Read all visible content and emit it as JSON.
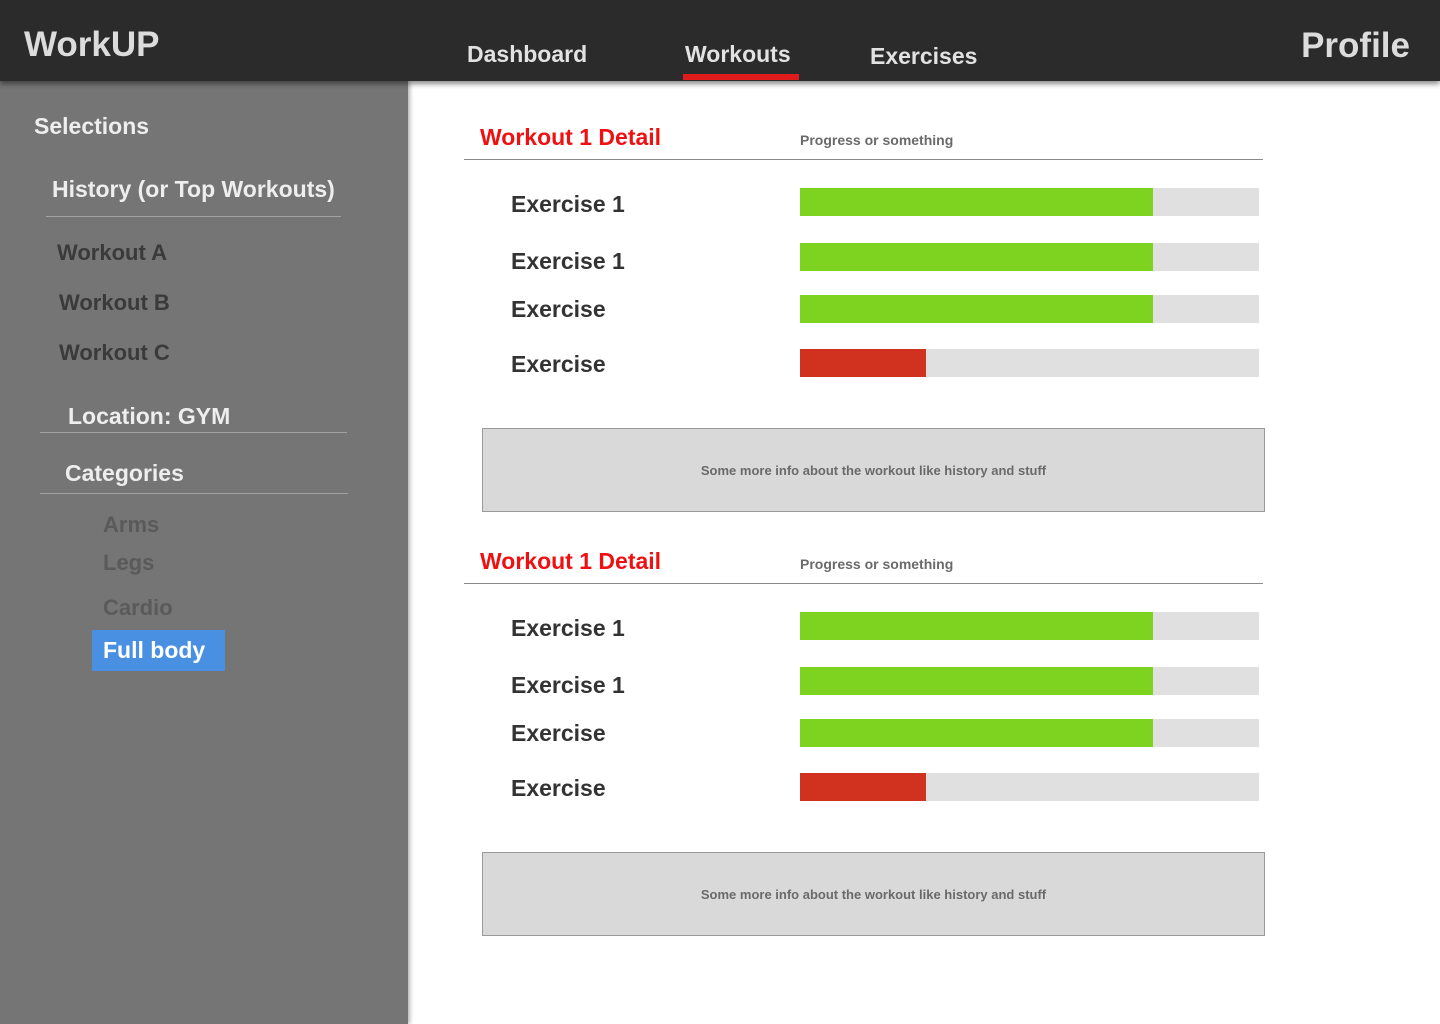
{
  "app": {
    "brand": "WorkUP",
    "profile": "Profile"
  },
  "nav": {
    "tabs": [
      {
        "label": "Dashboard"
      },
      {
        "label": "Workouts"
      },
      {
        "label": "Exercises"
      }
    ],
    "active_tab": "Workouts"
  },
  "sidebar": {
    "heading": "Selections",
    "history_heading": "History (or Top Workouts)",
    "workouts": [
      "Workout A",
      "Workout B",
      "Workout C"
    ],
    "location": "Location: GYM",
    "categories_heading": "Categories",
    "categories": [
      "Arms",
      "Legs",
      "Cardio",
      "Full body"
    ],
    "selected_category": "Full body"
  },
  "colors": {
    "accent": "#e01b1b",
    "title": "#ef1111",
    "progress_good": "#7ed321",
    "progress_bad": "#d0321f",
    "track": "#e0e0e0",
    "selected": "#4a90e2"
  },
  "sections": [
    {
      "title": "Workout 1 Detail",
      "subtitle": "Progress or something",
      "exercises": [
        {
          "label": "Exercise 1",
          "progress": 0.77,
          "status": "good"
        },
        {
          "label": "Exercise 1",
          "progress": 0.77,
          "status": "good"
        },
        {
          "label": "Exercise",
          "progress": 0.77,
          "status": "good"
        },
        {
          "label": "Exercise",
          "progress": 0.275,
          "status": "bad"
        }
      ],
      "info": "Some more info about the workout like history and stuff"
    },
    {
      "title": "Workout 1 Detail",
      "subtitle": "Progress or something",
      "exercises": [
        {
          "label": "Exercise 1",
          "progress": 0.77,
          "status": "good"
        },
        {
          "label": "Exercise 1",
          "progress": 0.77,
          "status": "good"
        },
        {
          "label": "Exercise",
          "progress": 0.77,
          "status": "good"
        },
        {
          "label": "Exercise",
          "progress": 0.275,
          "status": "bad"
        }
      ],
      "info": "Some more info about the workout like history and stuff"
    }
  ]
}
